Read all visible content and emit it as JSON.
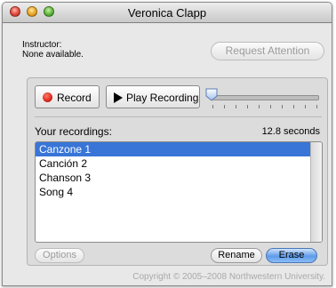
{
  "window": {
    "title": "Veronica Clapp"
  },
  "instructor": {
    "label": "Instructor:",
    "value": "None available."
  },
  "request_attention_label": "Request Attention",
  "controls": {
    "record_label": "Record",
    "play_label": "Play Recording",
    "playback_position": 0.0
  },
  "recordings": {
    "header": "Your recordings:",
    "duration": "12.8 seconds",
    "items": [
      "Canzone 1",
      "Canción 2",
      "Chanson 3",
      "Song 4"
    ],
    "selected_index": 0
  },
  "buttons": {
    "options_label": "Options",
    "rename_label": "Rename",
    "erase_label": "Erase"
  },
  "footer": {
    "copyright": "Copyright © 2005–2008 Northwestern University."
  },
  "colors": {
    "selection": "#3875d7",
    "record_dot": "#d8261a",
    "default_button": "#5f9bea"
  }
}
